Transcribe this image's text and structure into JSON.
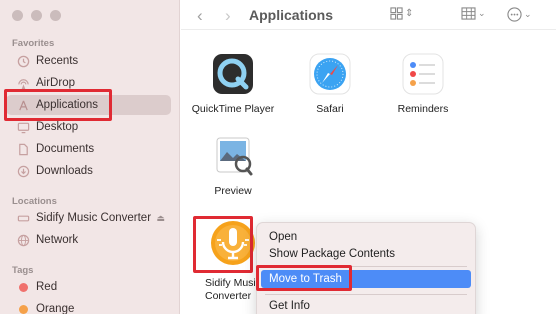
{
  "window": {
    "title": "Applications"
  },
  "sidebar": {
    "favorites_title": "Favorites",
    "favorites": [
      {
        "label": "Recents",
        "icon": "clock-icon"
      },
      {
        "label": "AirDrop",
        "icon": "airdrop-icon"
      },
      {
        "label": "Applications",
        "icon": "applications-icon"
      },
      {
        "label": "Desktop",
        "icon": "desktop-icon"
      },
      {
        "label": "Documents",
        "icon": "document-icon"
      },
      {
        "label": "Downloads",
        "icon": "download-icon"
      }
    ],
    "locations_title": "Locations",
    "locations": [
      {
        "label": "Sidify Music Converter",
        "icon": "drive-icon"
      },
      {
        "label": "Network",
        "icon": "network-icon"
      }
    ],
    "tags_title": "Tags",
    "tags": [
      {
        "label": "Red",
        "color": "#f0716d"
      },
      {
        "label": "Orange",
        "color": "#f5a14a"
      }
    ]
  },
  "apps": [
    {
      "label": "QuickTime Player"
    },
    {
      "label": "Safari"
    },
    {
      "label": "Reminders"
    },
    {
      "label": "Preview"
    },
    {
      "label_line1": "Sidify Music",
      "label_line2": "Converter"
    }
  ],
  "context_menu": {
    "open": "Open",
    "show_package": "Show Package Contents",
    "move_to_trash": "Move to Trash",
    "get_info": "Get Info"
  },
  "colors": {
    "highlight": "#4d8cf7",
    "annotation": "#e02a33"
  }
}
